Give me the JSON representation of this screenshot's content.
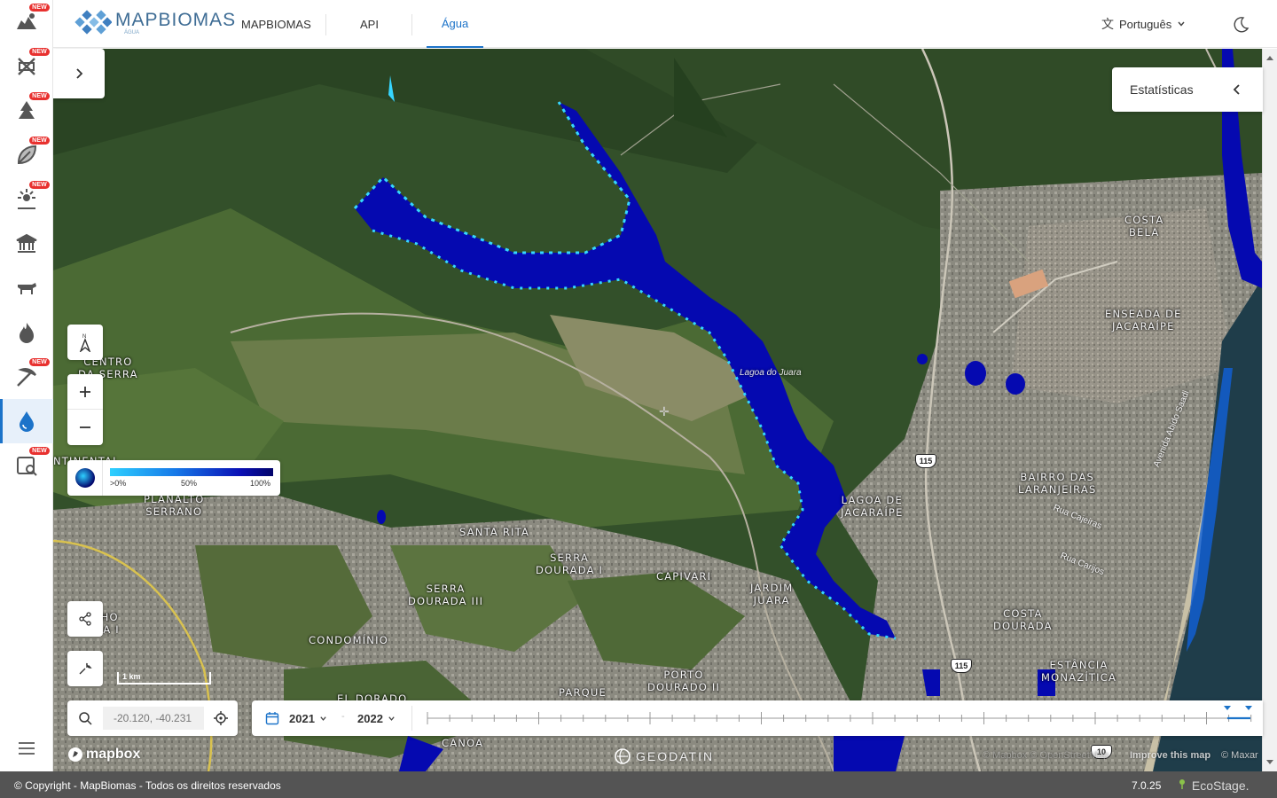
{
  "header": {
    "logo_text": "MAPBIOMAS",
    "logo_sub": "ÁGUA",
    "tabs": [
      {
        "label": "MAPBIOMAS",
        "active": false
      },
      {
        "label": "API",
        "active": false
      },
      {
        "label": "Água",
        "active": true
      }
    ],
    "language": "Português"
  },
  "sidebar": {
    "items": [
      {
        "icon": "collection-icon",
        "new": true
      },
      {
        "icon": "no-deforestation-icon",
        "new": true
      },
      {
        "icon": "degradation-icon",
        "new": true
      },
      {
        "icon": "leaf-icon",
        "new": true
      },
      {
        "icon": "irrigation-icon",
        "new": true
      },
      {
        "icon": "institution-icon",
        "new": false
      },
      {
        "icon": "cattle-icon",
        "new": false
      },
      {
        "icon": "fire-icon",
        "new": false
      },
      {
        "icon": "mining-icon",
        "new": true
      },
      {
        "icon": "water-drop-icon",
        "new": false,
        "active": true
      },
      {
        "icon": "image-analysis-icon",
        "new": true
      }
    ],
    "new_badge": "NEW"
  },
  "statistics": {
    "label": "Estatísticas"
  },
  "legend": {
    "min": ">0%",
    "mid": "50%",
    "max": "100%"
  },
  "search": {
    "value": "-20.120, -40.231"
  },
  "timeline": {
    "start_year": "2021",
    "end_year": "2022",
    "separator": "-"
  },
  "map": {
    "places": [
      {
        "name": "COSTA\nBELA"
      },
      {
        "name": "ENSEADA DE\nJACARAÍPE"
      },
      {
        "name": "CENTRO\nDA SERRA"
      },
      {
        "name": "BAIRRO DAS\nLARANJEIRAS"
      },
      {
        "name": "LAGOA DE\nJACARAÍPE"
      },
      {
        "name": "PLANALTO\nSERRANO"
      },
      {
        "name": "SANTA RITA"
      },
      {
        "name": "SERRA\nDOURADA I"
      },
      {
        "name": "SERRA\nDOURADA III"
      },
      {
        "name": "CAPIVARI"
      },
      {
        "name": "JARDIM\nJUARA"
      },
      {
        "name": "COSTA\nDOURADA"
      },
      {
        "name": "CONDOMÍNIO"
      },
      {
        "name": "PORTO\nDOURADO II"
      },
      {
        "name": "PARQUE"
      },
      {
        "name": "ESTÂNCIA\nMONAZÍTICA"
      },
      {
        "name": "PINHO\nERRA I"
      },
      {
        "name": "NTINENTAL"
      },
      {
        "name": "EL DORADO"
      },
      {
        "name": "CANOA"
      }
    ],
    "lake_label": "Lagoa do Juara",
    "roads": [
      "Avenida Abido Saadi",
      "Rua Cajeiras",
      "Rua Carijos"
    ],
    "shields": [
      "115",
      "115",
      "10"
    ],
    "scale_label": "1 km",
    "mapbox": "mapbox",
    "geodatin": "GEODATIN",
    "attribution": "Improve this map",
    "attribution2": "© Maxar",
    "attribution_faint": "© Mapbox © OpenStreetMap"
  },
  "footer": {
    "copyright": "© Copyright - MapBiomas - Todos os direitos reservados",
    "version": "7.0.25",
    "brand": "EcoStage."
  },
  "colors": {
    "accent": "#1c73c9",
    "water_deep": "#0a0fb5",
    "water_low": "#2ed0ff",
    "badge": "#e8312f"
  }
}
